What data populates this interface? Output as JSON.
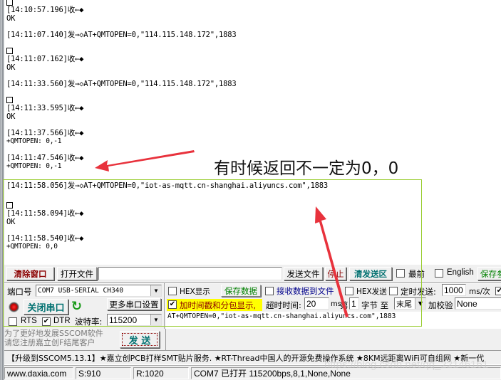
{
  "receive_log": [
    {
      "type": "box",
      "text": ""
    },
    {
      "type": "line",
      "text": "[14:10:57.196]收←◆"
    },
    {
      "type": "line",
      "text": "OK"
    },
    {
      "type": "line",
      "text": "[14:11:07.140]发→◇AT+QMTOPEN=0,\"114.115.148.172\",1883"
    },
    {
      "type": "box",
      "text": ""
    },
    {
      "type": "line",
      "text": "[14:11:07.162]收←◆"
    },
    {
      "type": "line",
      "text": "OK"
    },
    {
      "type": "line",
      "text": "[14:11:33.560]发→◇AT+QMTOPEN=0,\"114.115.148.172\",1883"
    },
    {
      "type": "box",
      "text": ""
    },
    {
      "type": "line",
      "text": "[14:11:33.595]收←◆"
    },
    {
      "type": "line",
      "text": "OK"
    },
    {
      "type": "line",
      "text": "[14:11:37.566]收←◆"
    },
    {
      "type": "line",
      "text": "+QMTOPEN: 0,-1"
    },
    {
      "type": "line",
      "text": "[14:11:47.546]收←◆"
    },
    {
      "type": "line",
      "text": "+QMTOPEN: 0,-1"
    },
    {
      "type": "line",
      "text": "[14:11:58.056]发→◇AT+QMTOPEN=0,\"iot-as-mqtt.cn-shanghai.aliyuncs.com\",1883"
    },
    {
      "type": "box",
      "text": ""
    },
    {
      "type": "line",
      "text": "[14:11:58.094]收←◆"
    },
    {
      "type": "line",
      "text": "OK"
    },
    {
      "type": "line",
      "text": "[14:11:58.540]收←◆"
    },
    {
      "type": "line",
      "text": "+QMTOPEN: 0,0"
    }
  ],
  "annotation": {
    "text": "有时候返回不一定为0，0",
    "arrow_color": "#e8323c"
  },
  "toolbar1": {
    "clear_window": "清除窗口",
    "open_file": "打开文件",
    "file_path": "",
    "send_file": "发送文件",
    "stop": "停止",
    "clear_send": "清发送区",
    "topmost_label": "最前",
    "topmost_checked": false,
    "english_label": "English",
    "english_checked": false,
    "save_config": "保存参数"
  },
  "port": {
    "label": "端口号",
    "value": "COM7 USB-SERIAL CH340",
    "close_port": "关闭串口",
    "more_settings": "更多串口设置",
    "rts_label": "RTS",
    "rts_checked": false,
    "dtr_label": "DTR",
    "dtr_checked": true,
    "baud_label": "波特率:",
    "baud_value": "115200"
  },
  "options": {
    "hex_display_label": "HEX显示",
    "hex_display_checked": false,
    "save_data": "保存数据",
    "recv_to_file_label": "接收数据到文件",
    "recv_to_file_checked": false,
    "hex_send_label": "HEX发送",
    "hex_send_checked": false,
    "timed_send_label": "定时发送:",
    "timed_send_checked": false,
    "timed_send_value": "1000",
    "timed_send_unit": "ms/次",
    "newline_checked": true,
    "timestamp_label": "加时间戳和分包显示,",
    "timestamp_checked": true,
    "timeout_label": "超时时间:",
    "timeout_value": "20",
    "timeout_unit": "ms",
    "byte_prefix": "第",
    "byte_value": "1",
    "byte_suffix": "字节 至",
    "byte_end": "末尾",
    "checksum_label": "加校验",
    "checksum_value": "None"
  },
  "send_area": {
    "text": "AT+QMTOPEN=0,\"iot-as-mqtt.cn-shanghai.aliyuncs.com\",1883",
    "send_button": "发 送"
  },
  "register_note": {
    "line1": "为了更好地发展SSCOM软件",
    "line2": "请您注册嘉立创F结尾客户"
  },
  "promo": "【升级到SSCOM5.13.1】★嘉立创PCB打样SMT贴片服务. ★RT-Thread中国人的开源免费操作系统 ★8KM远距离WiFi可自组网 ★新一代",
  "status_bar": {
    "website": "www.daxia.com",
    "sent": "S:910",
    "received": "R:1020",
    "port_status": "COM7 已打开  115200bps,8,1,None,None"
  },
  "watermark": "https://blog.csdn.net/qq_22146161"
}
